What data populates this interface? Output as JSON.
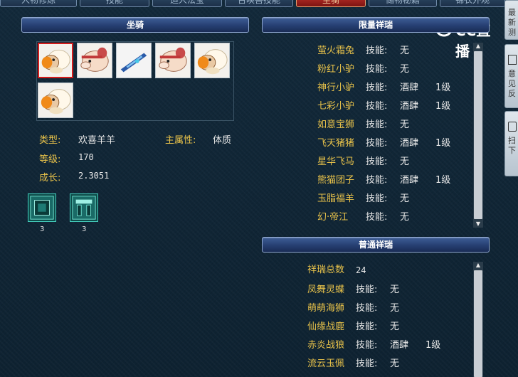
{
  "tabs": [
    {
      "label": "人物修炼"
    },
    {
      "label": "技能"
    },
    {
      "label": "造人法宝"
    },
    {
      "label": "召唤兽技能"
    },
    {
      "label": "坐骑"
    },
    {
      "label": "储物秘籍"
    },
    {
      "label": "锦衣外观"
    }
  ],
  "mount_panel": {
    "header": "坐骑",
    "type_label": "类型:",
    "type_value": "欢喜羊羊",
    "main_attr_label": "主属性:",
    "main_attr_value": "体质",
    "level_label": "等级:",
    "level_value": "170",
    "growth_label": "成长:",
    "growth_value": "2.3051",
    "skill_items": [
      {
        "icon": "jade-frame-icon",
        "count": "3"
      },
      {
        "icon": "jade-gate-icon",
        "count": "3"
      }
    ],
    "mounts": [
      {
        "icon": "sheep-mount-icon",
        "selected": true
      },
      {
        "icon": "donkey-mount-icon",
        "selected": false
      },
      {
        "icon": "sword-mount-icon",
        "selected": false
      },
      {
        "icon": "donkey-mount-icon",
        "selected": false
      },
      {
        "icon": "sheep-mount-icon",
        "selected": false
      },
      {
        "icon": "sheep-mount-icon",
        "selected": false
      }
    ]
  },
  "limited_panel": {
    "header": "限量祥瑞",
    "items": [
      {
        "name": "萤火霜兔",
        "skill_label": "技能:",
        "skill": "无",
        "level": ""
      },
      {
        "name": "粉红小驴",
        "skill_label": "技能:",
        "skill": "无",
        "level": ""
      },
      {
        "name": "神行小驴",
        "skill_label": "技能:",
        "skill": "酒肆",
        "level": "1级"
      },
      {
        "name": "七彩小驴",
        "skill_label": "技能:",
        "skill": "酒肆",
        "level": "1级"
      },
      {
        "name": "如意宝狮",
        "skill_label": "技能:",
        "skill": "无",
        "level": ""
      },
      {
        "name": "飞天猪猪",
        "skill_label": "技能:",
        "skill": "酒肆",
        "level": "1级"
      },
      {
        "name": "星华飞马",
        "skill_label": "技能:",
        "skill": "无",
        "level": ""
      },
      {
        "name": "熊猫团子",
        "skill_label": "技能:",
        "skill": "酒肆",
        "level": "1级"
      },
      {
        "name": "玉脂福羊",
        "skill_label": "技能:",
        "skill": "无",
        "level": ""
      },
      {
        "name": "幻·帝江",
        "skill_label": "技能:",
        "skill": "无",
        "level": ""
      }
    ]
  },
  "normal_panel": {
    "header": "普通祥瑞",
    "total_label": "祥瑞总数",
    "total_value": "24",
    "items": [
      {
        "name": "凤舞灵蝶",
        "skill_label": "技能:",
        "skill": "无",
        "level": ""
      },
      {
        "name": "萌萌海狮",
        "skill_label": "技能:",
        "skill": "无",
        "level": ""
      },
      {
        "name": "仙缘战鹿",
        "skill_label": "技能:",
        "skill": "无",
        "level": ""
      },
      {
        "name": "赤炎战狼",
        "skill_label": "技能:",
        "skill": "酒肆",
        "level": "1级"
      },
      {
        "name": "流云玉佩",
        "skill_label": "技能:",
        "skill": "无",
        "level": ""
      }
    ]
  },
  "side_strip": [
    "最新测",
    "意见反",
    "扫下"
  ],
  "watermark": {
    "text": "CC直播"
  }
}
